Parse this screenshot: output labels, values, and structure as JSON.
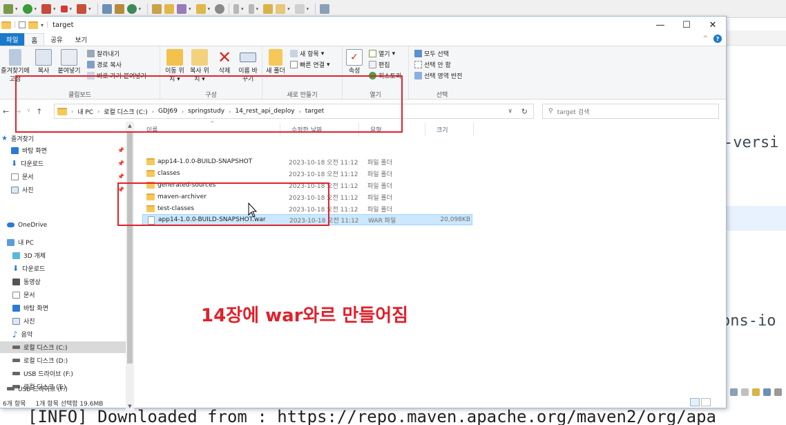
{
  "window": {
    "title": "target"
  },
  "ribbon_tabs": [
    "파일",
    "홈",
    "공유",
    "보기"
  ],
  "ribbon": {
    "clipboard": {
      "pin": "즐겨찾기에 고정",
      "copy": "복사",
      "paste": "붙여넣기",
      "cut": "잘라내기",
      "copy_path": "경로 복사",
      "paste_shortcut": "바로 가기 붙여넣기",
      "label": "클립보드"
    },
    "organize": {
      "move_to": "이동 위치",
      "copy_to": "복사 위치",
      "delete": "삭제",
      "rename": "이름 바꾸기",
      "label": "구성"
    },
    "new": {
      "new_folder": "새 폴더",
      "new_item": "새 항목",
      "easy_access": "빠른 연결",
      "label": "새로 만들기"
    },
    "open": {
      "properties": "속성",
      "open": "열기",
      "edit": "편집",
      "history": "히스토리",
      "label": "열기"
    },
    "select": {
      "select_all": "모두 선택",
      "select_none": "선택 안 함",
      "invert": "선택 영역 반전",
      "label": "선택"
    }
  },
  "address": {
    "crumbs": [
      "내 PC",
      "로컬 디스크 (C:)",
      "GDJ69",
      "springstudy",
      "14_rest_api_deploy",
      "target"
    ],
    "search_placeholder": "target 검색"
  },
  "nav": {
    "quick_access": "즐겨찾기",
    "quick_items": [
      "바탕 화면",
      "다운로드",
      "문서",
      "사진"
    ],
    "onedrive": "OneDrive",
    "this_pc": "내 PC",
    "pc_items": [
      "3D 개체",
      "다운로드",
      "동영상",
      "문서",
      "바탕 화면",
      "사진",
      "음악",
      "로컬 디스크 (C:)",
      "로컬 디스크 (D:)",
      "USB 드라이브 (F:)",
      "로컬 디스크 (T:)"
    ],
    "usb": "USB 드라이브 (F:)"
  },
  "columns": {
    "name": "이름",
    "date": "수정한 날짜",
    "type": "유형",
    "size": "크기"
  },
  "files": [
    {
      "name": "app14-1.0.0-BUILD-SNAPSHOT",
      "date": "2023-10-18 오전 11:12",
      "type": "파일 폴더",
      "size": "",
      "kind": "folder"
    },
    {
      "name": "classes",
      "date": "2023-10-18 오전 11:12",
      "type": "파일 폴더",
      "size": "",
      "kind": "folder"
    },
    {
      "name": "generated-sources",
      "date": "2023-10-18 오전 11:12",
      "type": "파일 폴더",
      "size": "",
      "kind": "folder"
    },
    {
      "name": "maven-archiver",
      "date": "2023-10-18 오전 11:12",
      "type": "파일 폴더",
      "size": "",
      "kind": "folder"
    },
    {
      "name": "test-classes",
      "date": "2023-10-18 오전 11:12",
      "type": "파일 폴더",
      "size": "",
      "kind": "folder"
    },
    {
      "name": "app14-1.0.0-BUILD-SNAPSHOT.war",
      "date": "2023-10-18 오전 11:12",
      "type": "WAR 파일",
      "size": "20,098KB",
      "kind": "file"
    }
  ],
  "status": {
    "count": "6개 항목",
    "selected": "1개 항목 선택함 19.6MB"
  },
  "annotation": "14장에 war와르 만들어짐",
  "eclipse": {
    "code_fragments": [
      "-versi",
      "ons-io"
    ],
    "console_line": "[INFO] Downloaded from : https://repo.maven.apache.org/maven2/org/apa"
  },
  "colors": {
    "annotation": "#e0212b",
    "selection": "#cce8ff",
    "file_tab": "#1979ca",
    "folder": "#f6c85a"
  }
}
